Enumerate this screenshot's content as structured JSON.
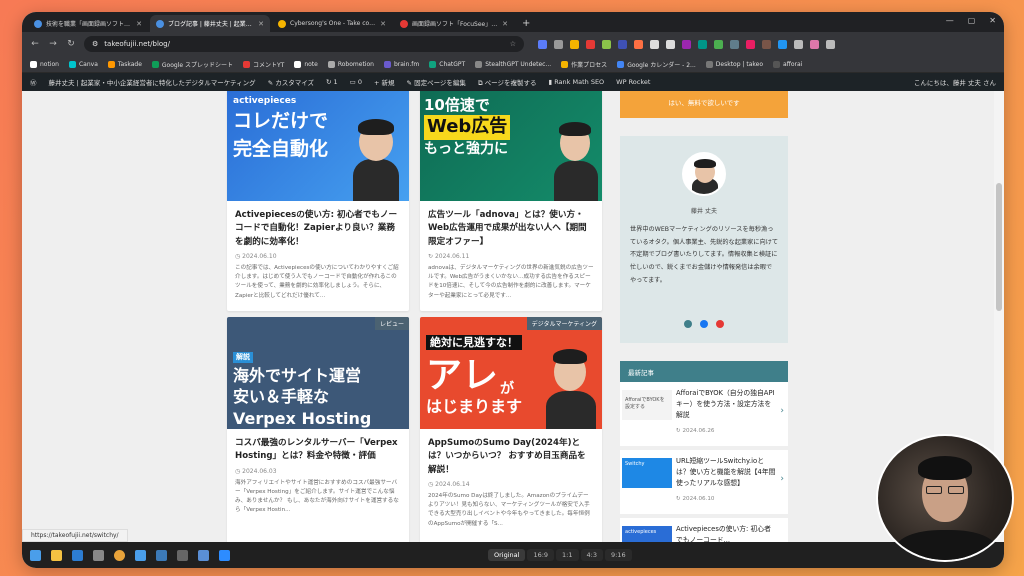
{
  "browser": {
    "tabs": [
      {
        "title": "技術を職業「画面録画ソフト「Fe...",
        "active": false,
        "color": "#4a90e2"
      },
      {
        "title": "ブログ記事 | 藤井丈夫 | 起業家...",
        "active": true,
        "color": "#4a90e2"
      },
      {
        "title": "Cybersong's One - Take contro...",
        "active": false,
        "color": "#f5b400"
      },
      {
        "title": "画面録画ソフト「FocuSee」で超カ...",
        "active": false,
        "color": "#e53935"
      }
    ],
    "new_tab": "+",
    "url": "takeofujii.net/blog/",
    "bookmarks": [
      "notion",
      "Canva",
      "Taskade",
      "Google スプレッドシート",
      "コメントYT",
      "note",
      "Robometion",
      "brain.fm",
      "ChatGPT",
      "StealthGPT Undetec...",
      "作業プロセス",
      "Google カレンダー - 2...",
      "Desktop | takeo",
      "afforai"
    ]
  },
  "wpbar": {
    "site": "藤井丈夫 | 起業家・中小企業経営者に特化したデジタルマーケティング",
    "customize": "カスタマイズ",
    "updates": "1",
    "comments": "0",
    "new": "新規",
    "fixed_page": "固定ページを編集",
    "duplicate": "ページを複製する",
    "rankmath": "Rank Math SEO",
    "wprocket": "WP Rocket",
    "greeting": "こんにちは、藤井 丈夫 さん"
  },
  "posts": [
    {
      "thumb_lines": [
        "activepieces",
        "コレだけで",
        "完全自動化"
      ],
      "category": "",
      "title": "Activepiecesの使い方: 初心者でもノーコードで自動化！Zapierより良い？業務を劇的に効率化！",
      "date": "2024.06.10",
      "excerpt": "この記事では、Activepiecesの使い方についてわかりやすくご紹介します。はじめて使う人でもノーコードで自動化が作れるこのツールを使って、業務を劇的に効率化しましょう。そらに、Zapierと比較してどれだけ優れて..."
    },
    {
      "thumb_lines": [
        "10倍速で",
        "Web広告",
        "もっと強力に"
      ],
      "category": "",
      "title": "広告ツール「adnova」とは？使い方・Web広告運用で成果が出ない人へ【期間限定オファー】",
      "date": "2024.06.11",
      "excerpt": "adnovaは、デジタルマーケティングの世界の新進気鋭の広告ツールです。Web広告がうまくいかない…成功する広告を作るスピードを10倍速に、そして今の広告制作を劇的に改善します。マーケターや起業家にとって必見です..."
    },
    {
      "thumb_lines": [
        "解説",
        "海外でサイト運営",
        "安い＆手軽な",
        "Verpex Hosting"
      ],
      "category": "レビュー",
      "title": "コスパ最強のレンタルサーバー「Verpex Hosting」とは？料金や特徴・評価",
      "date": "2024.06.03",
      "excerpt": "海外アフィリエイトやサイト運営におすすめのコスパ最強サーバー「Verpex Hosting」をご紹介します。サイト運営でこんな悩み、ありませんか？ もし、あなたが海外向けサイトを運営するなら「Verpex Hostin..."
    },
    {
      "thumb_lines": [
        "絶対に見逃すな！",
        "アレ",
        "が",
        "はじまります"
      ],
      "category": "デジタルマーケティング",
      "title": "AppSumoのSumo Day(2024年)とは？いつからいつ？ おすすめ目玉商品を解説！",
      "date": "2024.06.14",
      "excerpt": "2024年のSumo Dayは終了しました。Amazonのプライムデーよりアツい！見も知らない、マーケティングツールが格安で入手できる大型売り出しイベントや今年もやってきました。毎年恒例のAppSumoが開催する「S..."
    }
  ],
  "sidebar": {
    "cta": "はい、無料で欲しいです",
    "name": "藤井 丈夫",
    "bio": "世界中のWEBマーケティングのリソースを毎秒漁っているオタク。個人事業主、先鋭的な起業家に向けて不定期でブログ書いたりしてます。情報収集と検証に忙しいので、鋭くまでお金儲けや情報発信は余暇でやってます。",
    "recent_heading": "最新記事",
    "recent": [
      {
        "thumb": "AfforaiでBYOKを設定する",
        "title": "AfforaiでBYOK（自分の独自APIキー）を使う方法・設定方法を解説",
        "date": "2024.06.26"
      },
      {
        "thumb": "Switchy",
        "title": "URL短縮ツールSwitchy.ioとは？使い方と機能を解説【4年間使ったリアルな感想】",
        "date": "2024.06.10"
      },
      {
        "thumb": "activepieces",
        "title": "Activepiecesの使い方: 初心者でもノーコード...",
        "date": ""
      }
    ]
  },
  "status_link": "https://takeofujii.net/switchy/",
  "ratio_options": [
    "Original",
    "16:9",
    "1:1",
    "4:3",
    "9:16"
  ],
  "ratio_selected": "Original"
}
